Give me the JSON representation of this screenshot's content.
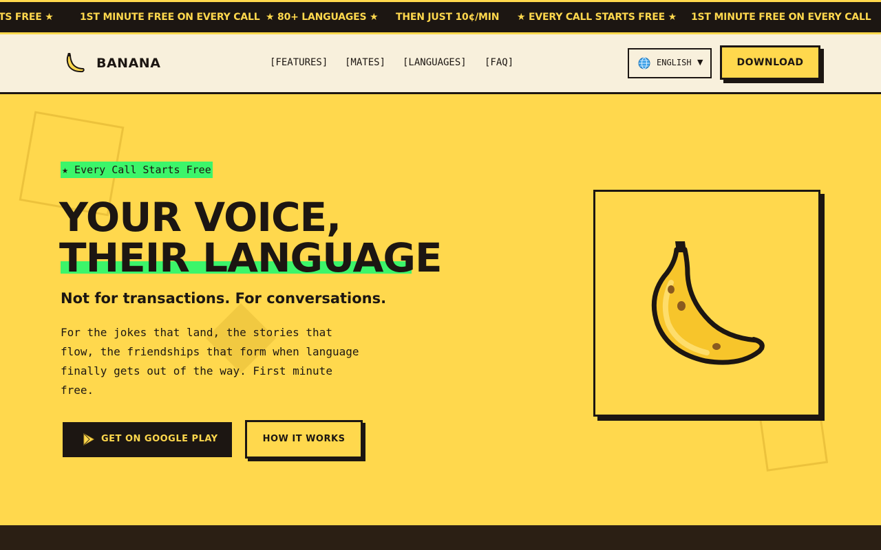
{
  "ticker": {
    "items": [
      "TS FREE ★",
      "1ST MINUTE FREE ON EVERY CALL",
      "★ 80+ LANGUAGES ★",
      "THEN JUST 10¢/MIN",
      "★ EVERY CALL STARTS FREE ★",
      "1ST MINUTE FREE ON EVERY CALL"
    ]
  },
  "header": {
    "brand": "BANANA",
    "nav": [
      "[FEATURES]",
      "[MATES]",
      "[LANGUAGES]",
      "[FAQ]"
    ],
    "language": "ENGLISH",
    "download_label": "DOWNLOAD"
  },
  "hero": {
    "badge": "★ Every Call Starts Free",
    "headline_line1": "YOUR VOICE,",
    "headline_line2": "THEIR LANGUAGE",
    "subheadline": "Not for transactions. For conversations.",
    "paragraph": "For the jokes that land, the stories that flow, the friendships that form when language finally gets out of the way. First minute free.",
    "primary_cta": "GET ON GOOGLE PLAY",
    "secondary_cta": "HOW IT WORKS"
  },
  "colors": {
    "accent_yellow": "#ffd84d",
    "highlight_green": "#3cf56a",
    "ink": "#1c1612",
    "cream": "#f8f0dc"
  },
  "icons": [
    "banana-logo-icon",
    "globe-icon",
    "caret-down-icon",
    "google-play-icon",
    "banana-illustration"
  ]
}
